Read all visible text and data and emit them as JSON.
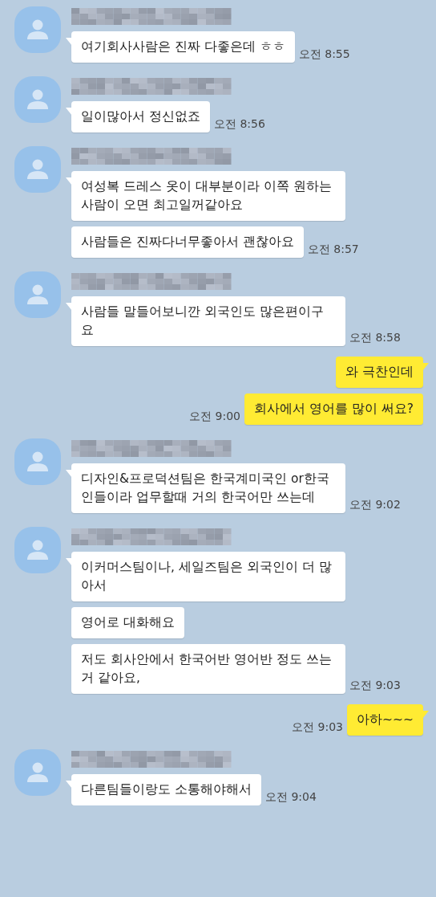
{
  "messages": [
    {
      "kind": "received",
      "bubbles": [
        {
          "text": "여기회사사람은 진짜 다좋은데 ㅎㅎ",
          "time": "오전 8:55"
        }
      ]
    },
    {
      "kind": "received",
      "bubbles": [
        {
          "text": "일이많아서 정신없죠",
          "time": "오전 8:56"
        }
      ]
    },
    {
      "kind": "received",
      "bubbles": [
        {
          "text": "여성복 드레스 옷이 대부분이라 이쪽 원하는 사람이 오면 최고일꺼같아요"
        },
        {
          "text": "사람들은 진짜다너무좋아서 괜찮아요",
          "time": "오전 8:57"
        }
      ]
    },
    {
      "kind": "received",
      "bubbles": [
        {
          "text": "사람들 말들어보니깐 외국인도 많은편이구요",
          "time": "오전 8:58"
        }
      ]
    },
    {
      "kind": "sent",
      "bubbles": [
        {
          "text": "와 극찬인데"
        },
        {
          "text": "회사에서 영어를 많이 써요?",
          "time": "오전 9:00"
        }
      ]
    },
    {
      "kind": "received",
      "bubbles": [
        {
          "text": "디자인&프로덕션팀은 한국계미국인 or한국인들이라 업무할때 거의 한국어만 쓰는데",
          "time": "오전 9:02"
        }
      ]
    },
    {
      "kind": "received",
      "bubbles": [
        {
          "text": "이커머스팀이나, 세일즈팀은 외국인이 더 많아서"
        },
        {
          "text": "영어로 대화해요"
        },
        {
          "text": "저도 회사안에서 한국어반 영어반 정도 쓰는거 같아요,",
          "time": "오전 9:03"
        }
      ]
    },
    {
      "kind": "sent",
      "bubbles": [
        {
          "text": "아하~~~",
          "time": "오전 9:03"
        }
      ]
    },
    {
      "kind": "received",
      "bubbles": [
        {
          "text": "다른팀들이랑도 소통해야해서",
          "time": "오전 9:04"
        }
      ]
    }
  ]
}
